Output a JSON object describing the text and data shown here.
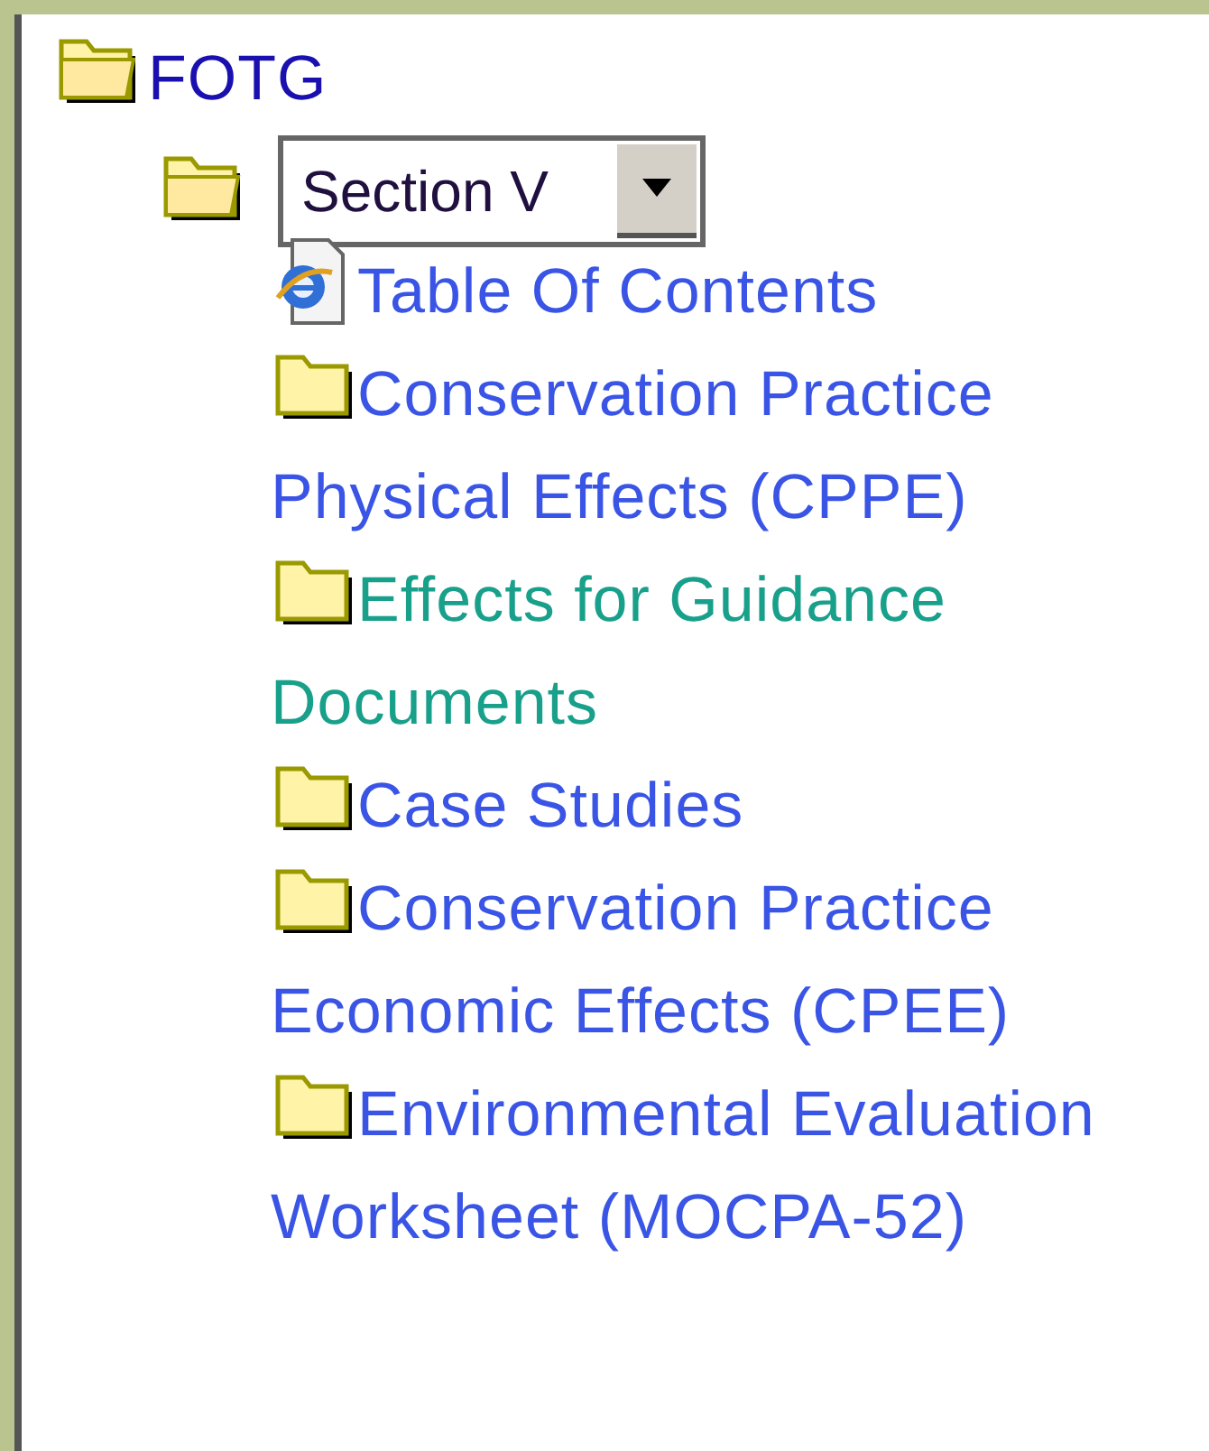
{
  "tree": {
    "label": "FOTG",
    "children": [
      {
        "kind": "select",
        "value": "Section V",
        "children": [
          {
            "kind": "page",
            "label": "Table Of Contents",
            "visited": false
          },
          {
            "kind": "folder",
            "label": "Conservation Practice Physical Effects (CPPE)",
            "visited": false
          },
          {
            "kind": "folder",
            "label": "Effects for Guidance Documents",
            "visited": true
          },
          {
            "kind": "folder",
            "label": "Case Studies",
            "visited": false
          },
          {
            "kind": "folder",
            "label": "Conservation Practice Economic Effects (CPEE)",
            "visited": false
          },
          {
            "kind": "folder",
            "label": "Environmental Evaluation Worksheet (MOCPA-52)",
            "visited": false
          }
        ]
      }
    ]
  }
}
